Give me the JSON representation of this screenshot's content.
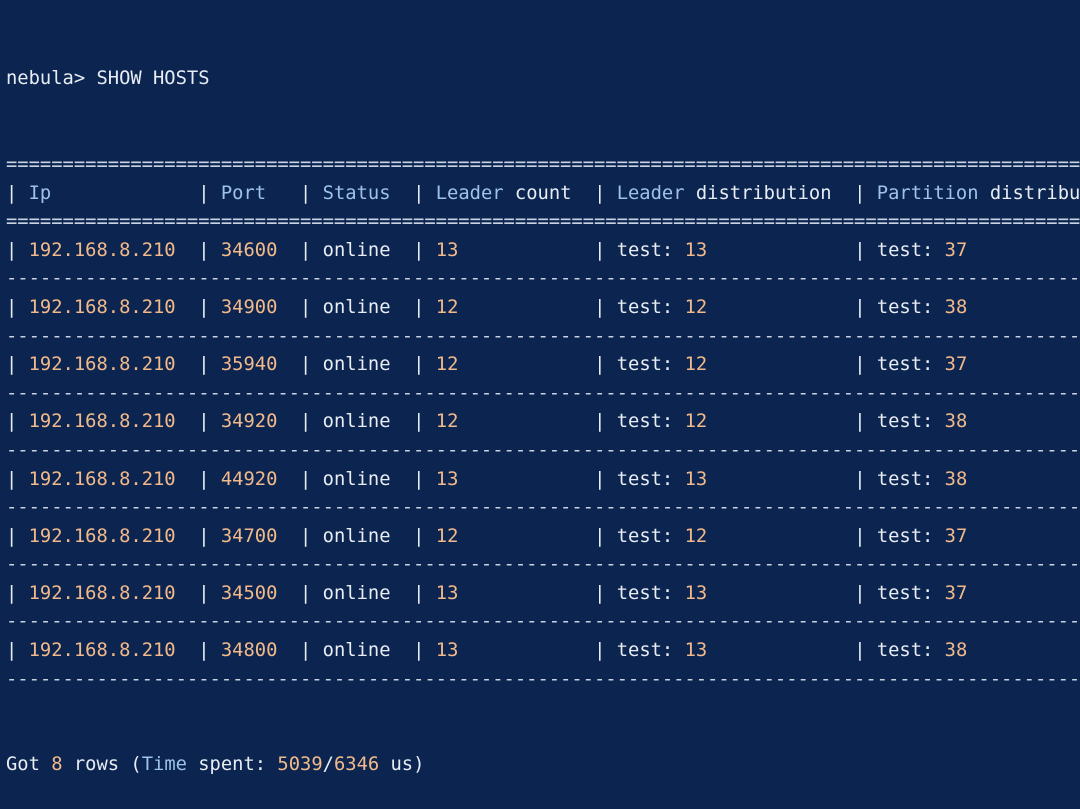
{
  "prompt": "nebula>",
  "command": "SHOW HOSTS",
  "colors": {
    "background": "#0c2550",
    "text": "#e8edf4",
    "number": "#f2b98a",
    "keyword": "#9ec3ea"
  },
  "table": {
    "headers": [
      {
        "kw": "Ip",
        "rest": ""
      },
      {
        "kw": "Port",
        "rest": ""
      },
      {
        "kw": "Status",
        "rest": ""
      },
      {
        "kw": "Leader",
        "rest": " count"
      },
      {
        "kw": "Leader",
        "rest": " distribution"
      },
      {
        "kw": "Partition",
        "rest": " distribution"
      }
    ],
    "rows": [
      {
        "ip": "192.168.8.210",
        "port": "34600",
        "status": "online",
        "leader_count": "13",
        "ld_space": "test:",
        "ld_value": "13",
        "pd_space": "test:",
        "pd_value": "37"
      },
      {
        "ip": "192.168.8.210",
        "port": "34900",
        "status": "online",
        "leader_count": "12",
        "ld_space": "test:",
        "ld_value": "12",
        "pd_space": "test:",
        "pd_value": "38"
      },
      {
        "ip": "192.168.8.210",
        "port": "35940",
        "status": "online",
        "leader_count": "12",
        "ld_space": "test:",
        "ld_value": "12",
        "pd_space": "test:",
        "pd_value": "37"
      },
      {
        "ip": "192.168.8.210",
        "port": "34920",
        "status": "online",
        "leader_count": "12",
        "ld_space": "test:",
        "ld_value": "12",
        "pd_space": "test:",
        "pd_value": "38"
      },
      {
        "ip": "192.168.8.210",
        "port": "44920",
        "status": "online",
        "leader_count": "13",
        "ld_space": "test:",
        "ld_value": "13",
        "pd_space": "test:",
        "pd_value": "38"
      },
      {
        "ip": "192.168.8.210",
        "port": "34700",
        "status": "online",
        "leader_count": "12",
        "ld_space": "test:",
        "ld_value": "12",
        "pd_space": "test:",
        "pd_value": "37"
      },
      {
        "ip": "192.168.8.210",
        "port": "34500",
        "status": "online",
        "leader_count": "13",
        "ld_space": "test:",
        "ld_value": "13",
        "pd_space": "test:",
        "pd_value": "37"
      },
      {
        "ip": "192.168.8.210",
        "port": "34800",
        "status": "online",
        "leader_count": "13",
        "ld_space": "test:",
        "ld_value": "13",
        "pd_space": "test:",
        "pd_value": "38"
      }
    ]
  },
  "footer": {
    "got": "Got",
    "count": "8",
    "rows": "rows (",
    "time_kw": "Time",
    "spent": "spent:",
    "latency": "5039",
    "slash": "/",
    "total": "6346",
    "unit": "us)"
  }
}
